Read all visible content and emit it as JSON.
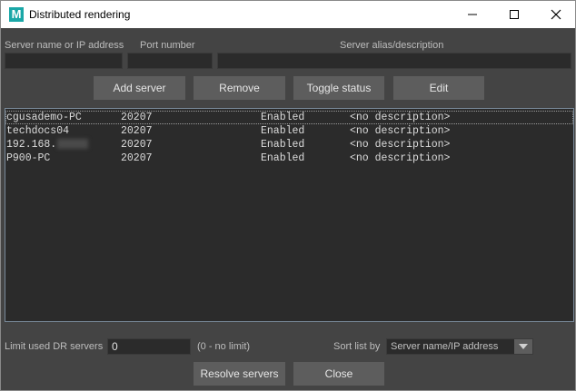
{
  "window": {
    "title": "Distributed rendering",
    "app_icon_letter": "M",
    "controls": [
      "minimize-icon",
      "maximize-icon",
      "close-icon"
    ]
  },
  "form": {
    "server_label": "Server name or IP address",
    "port_label": "Port number",
    "alias_label": "Server alias/description",
    "server_value": "",
    "port_value": "",
    "alias_value": ""
  },
  "buttons": {
    "add": "Add server",
    "remove": "Remove",
    "toggle": "Toggle status",
    "edit": "Edit",
    "resolve": "Resolve servers",
    "close": "Close"
  },
  "servers": [
    {
      "name": "cgusademo-PC",
      "port": "20207",
      "status": "Enabled",
      "description": "<no description>"
    },
    {
      "name": "techdocs04",
      "port": "20207",
      "status": "Enabled",
      "description": "<no description>"
    },
    {
      "name": "192.168.",
      "port": "20207",
      "status": "Enabled",
      "description": "<no description>"
    },
    {
      "name": "P900-PC",
      "port": "20207",
      "status": "Enabled",
      "description": "<no description>"
    }
  ],
  "footer": {
    "limit_label": "Limit used DR servers",
    "limit_value": "0",
    "limit_hint": "(0 - no limit)",
    "sort_label": "Sort list by",
    "sort_value": "Server name/IP address"
  },
  "colors": {
    "background": "#444444",
    "field": "#2b2b2b",
    "button": "#5d5d5d",
    "app_icon": "#1aa7a7"
  }
}
